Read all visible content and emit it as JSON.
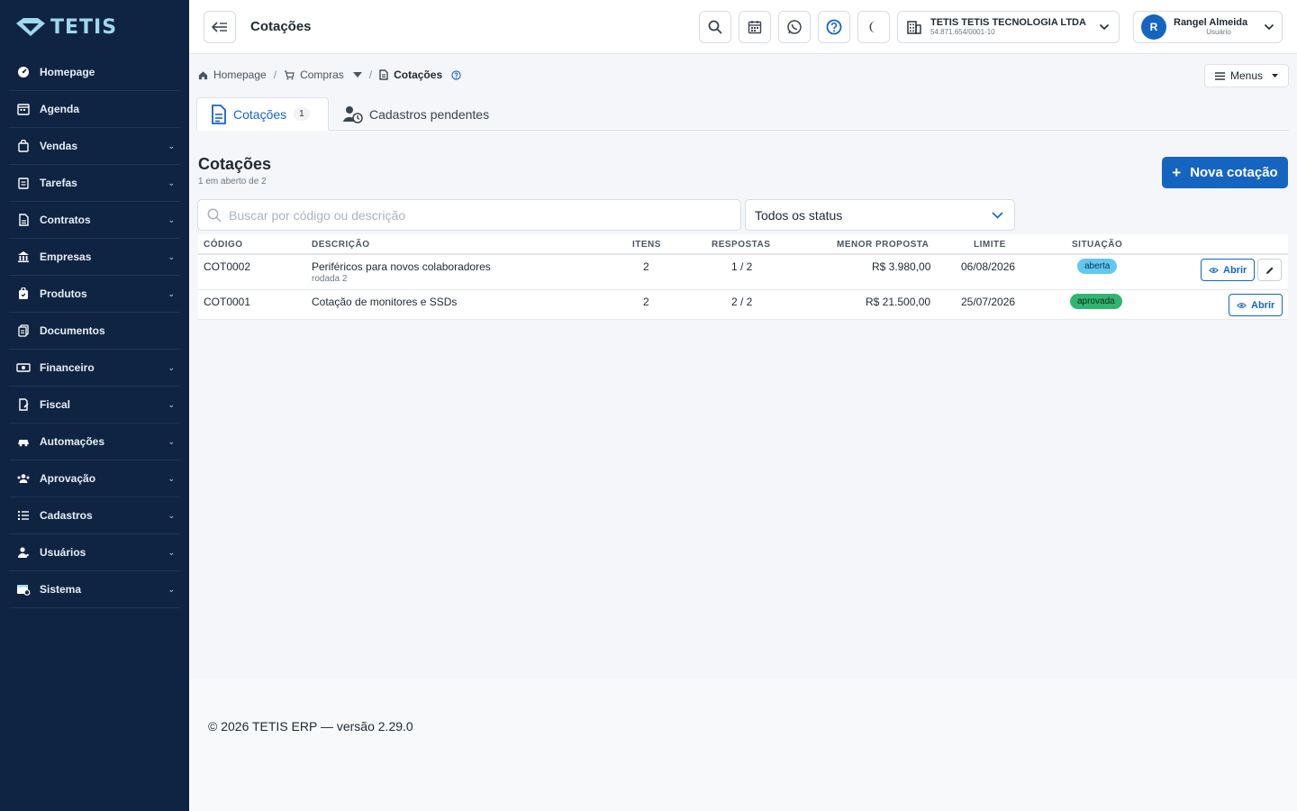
{
  "brand": {
    "name": "TETIS",
    "accent": "#9fd8ef",
    "sidebar_bg": "#0f2442",
    "primary": "#1565c0"
  },
  "sidebar": {
    "items": [
      {
        "label": "Homepage",
        "icon": "dashboard-icon",
        "expandable": false
      },
      {
        "label": "Agenda",
        "icon": "calendar-icon",
        "expandable": false
      },
      {
        "label": "Vendas",
        "icon": "bag-icon",
        "expandable": true
      },
      {
        "label": "Tarefas",
        "icon": "clipboard-icon",
        "expandable": true
      },
      {
        "label": "Contratos",
        "icon": "contract-icon",
        "expandable": true
      },
      {
        "label": "Empresas",
        "icon": "bank-icon",
        "expandable": true
      },
      {
        "label": "Produtos",
        "icon": "box-icon",
        "expandable": true
      },
      {
        "label": "Documentos",
        "icon": "documents-icon",
        "expandable": false
      },
      {
        "label": "Financeiro",
        "icon": "money-icon",
        "expandable": true
      },
      {
        "label": "Fiscal",
        "icon": "fiscal-icon",
        "expandable": true
      },
      {
        "label": "Automações",
        "icon": "car-icon",
        "expandable": true
      },
      {
        "label": "Aprovação",
        "icon": "team-icon",
        "expandable": true
      },
      {
        "label": "Cadastros",
        "icon": "list-icon",
        "expandable": true
      },
      {
        "label": "Usuários",
        "icon": "user-icon",
        "expandable": true
      },
      {
        "label": "Sistema",
        "icon": "system-icon",
        "expandable": true
      }
    ]
  },
  "topbar": {
    "title": "Cotações",
    "company": {
      "name": "TETIS TETIS TECNOLOGIA LTDA",
      "doc": "54.871.654/0001-10"
    },
    "user": {
      "initial": "R",
      "name": "Rangel Almeida",
      "role": "Usuário"
    }
  },
  "breadcrumb": {
    "home": "Homepage",
    "parent": "Compras",
    "current": "Cotações"
  },
  "menus_label": "Menus",
  "tabs": [
    {
      "label": "Cotações",
      "count": "1"
    },
    {
      "label": "Cadastros pendentes"
    }
  ],
  "section": {
    "title": "Cotações",
    "subtitle": "1 em aberto de 2",
    "new_button": "Nova cotação"
  },
  "filters": {
    "search_placeholder": "Buscar por código ou descrição",
    "status_selected": "Todos os status"
  },
  "table": {
    "headers": {
      "code": "CÓDIGO",
      "description": "DESCRIÇÃO",
      "items": "ITENS",
      "responses": "RESPOSTAS",
      "lowest": "MENOR PROPOSTA",
      "deadline": "LIMITE",
      "status": "SITUAÇÃO"
    },
    "rows": [
      {
        "code": "COT0002",
        "description": "Periféricos para novos colaboradores",
        "round": "rodada 2",
        "items": "2",
        "responses": "1 / 2",
        "lowest": "R$ 3.980,00",
        "deadline": "06/08/2026",
        "status": "aberta",
        "open_label": "Abrir"
      },
      {
        "code": "COT0001",
        "description": "Cotação de monitores e SSDs",
        "items": "2",
        "responses": "2 / 2",
        "lowest": "R$ 21.500,00",
        "deadline": "25/07/2026",
        "status": "aprovada",
        "open_label": "Abrir"
      }
    ]
  },
  "footer": {
    "text": "© 2026 TETIS ERP — versão 2.29.0"
  }
}
